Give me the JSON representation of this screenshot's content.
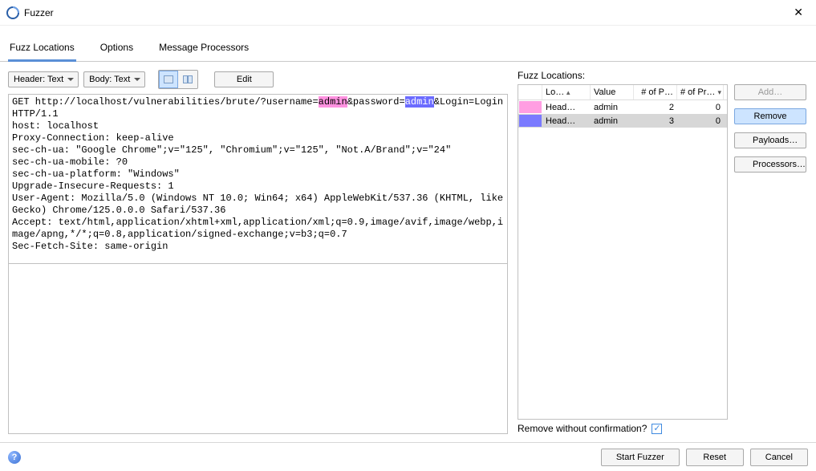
{
  "window": {
    "title": "Fuzzer"
  },
  "tabs": {
    "t0": "Fuzz Locations",
    "t1": "Options",
    "t2": "Message Processors"
  },
  "toolbar": {
    "header_dd": "Header: Text",
    "body_dd": "Body: Text",
    "edit": "Edit"
  },
  "request": {
    "p1": "GET http://localhost/vulnerabilities/brute/?username=",
    "h1": "admin",
    "p2": "&password=",
    "h2": "admin",
    "p3": "&Login=Login HTTP/1.1\nhost: localhost\nProxy-Connection: keep-alive\nsec-ch-ua: \"Google Chrome\";v=\"125\", \"Chromium\";v=\"125\", \"Not.A/Brand\";v=\"24\"\nsec-ch-ua-mobile: ?0\nsec-ch-ua-platform: \"Windows\"\nUpgrade-Insecure-Requests: 1\nUser-Agent: Mozilla/5.0 (Windows NT 10.0; Win64; x64) AppleWebKit/537.36 (KHTML, like Gecko) Chrome/125.0.0.0 Safari/537.36\nAccept: text/html,application/xhtml+xml,application/xml;q=0.9,image/avif,image/webp,image/apng,*/*;q=0.8,application/signed-exchange;v=b3;q=0.7\nSec-Fetch-Site: same-origin"
  },
  "locations": {
    "title": "Fuzz Locations:",
    "headers": {
      "loc": "Lo…",
      "value": "Value",
      "np": "# of P…",
      "npr": "# of Pro…"
    },
    "rows": [
      {
        "color": "#ff9ee2",
        "loc": "Head…",
        "value": "admin",
        "np": "2",
        "npr": "0",
        "selected": false
      },
      {
        "color": "#7a7aff",
        "loc": "Head…",
        "value": "admin",
        "np": "3",
        "npr": "0",
        "selected": true
      }
    ],
    "remove_confirm": "Remove without confirmation?"
  },
  "side": {
    "add": "Add…",
    "remove": "Remove",
    "payloads": "Payloads…",
    "processors": "Processors…"
  },
  "footer": {
    "start": "Start Fuzzer",
    "reset": "Reset",
    "cancel": "Cancel"
  }
}
